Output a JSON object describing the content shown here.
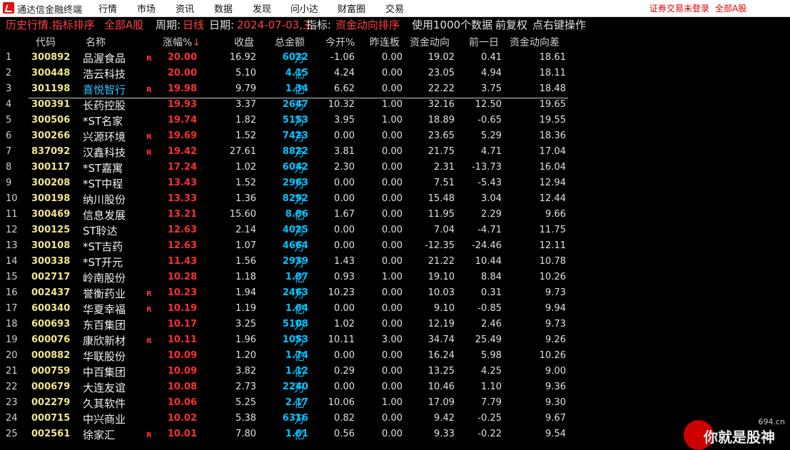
{
  "app": {
    "name": "通达信金融终端"
  },
  "menu": [
    "行情",
    "市场",
    "资讯",
    "数据",
    "发现",
    "问小达",
    "财富圈",
    "交易"
  ],
  "status": {
    "login": "证券交易未登录",
    "market": "全部A股"
  },
  "info": {
    "title": "历史行情.指标排序",
    "scope": "全部A股",
    "period_label": "周期:",
    "period": "日线",
    "date_label": "日期:",
    "date": "2024-07-03,三",
    "indicator_label": "指标:",
    "indicator": "资金动向排序",
    "data_note": "使用1000个数据",
    "adjust": "前复权",
    "hint": "点右键操作"
  },
  "columns": [
    "代码",
    "名称",
    "涨幅%",
    "收盘",
    "总金额",
    "今开%",
    "昨连板",
    "资金动向",
    "前一日",
    "资金动向差"
  ],
  "sort_arrow": "↓",
  "colors": {
    "up": "#ff3030",
    "code": "#f0e68c",
    "amount": "#00c4ff",
    "selected_name": "#2ec7ff"
  },
  "rows": [
    {
      "idx": "1",
      "code": "300892",
      "name": "品渥食品",
      "mark": "R",
      "chg": "20.00",
      "close": "16.92",
      "amt": "6022",
      "unit": "万",
      "open": "-1.06",
      "streak": "0.00",
      "flow": "19.02",
      "prev": "0.41",
      "diff": "18.61"
    },
    {
      "idx": "2",
      "code": "300448",
      "name": "浩云科技",
      "mark": "",
      "chg": "20.00",
      "close": "5.10",
      "amt": "4.15",
      "unit": "亿",
      "open": "4.24",
      "streak": "0.00",
      "flow": "23.05",
      "prev": "4.94",
      "diff": "18.11"
    },
    {
      "idx": "3",
      "code": "301198",
      "name": "喜悦智行",
      "mark": "R",
      "chg": "19.98",
      "close": "9.79",
      "amt": "1.34",
      "unit": "亿",
      "open": "6.62",
      "streak": "0.00",
      "flow": "22.22",
      "prev": "3.75",
      "diff": "18.48"
    },
    {
      "idx": "4",
      "code": "300391",
      "name": "长药控股",
      "mark": "",
      "chg": "19.93",
      "close": "3.37",
      "amt": "2647",
      "unit": "万",
      "open": "10.32",
      "streak": "1.00",
      "flow": "32.16",
      "prev": "12.50",
      "diff": "19.65"
    },
    {
      "idx": "5",
      "code": "300506",
      "name": "*ST名家",
      "mark": "",
      "chg": "19.74",
      "close": "1.82",
      "amt": "5153",
      "unit": "万",
      "open": "3.95",
      "streak": "1.00",
      "flow": "18.89",
      "prev": "-0.65",
      "diff": "19.55"
    },
    {
      "idx": "6",
      "code": "300266",
      "name": "兴源环境",
      "mark": "R",
      "chg": "19.69",
      "close": "1.52",
      "amt": "7423",
      "unit": "万",
      "open": "0.00",
      "streak": "0.00",
      "flow": "23.65",
      "prev": "5.29",
      "diff": "18.36"
    },
    {
      "idx": "7",
      "code": "837092",
      "name": "汉鑫科技",
      "mark": "R",
      "chg": "19.42",
      "close": "27.61",
      "amt": "8822",
      "unit": "万",
      "open": "3.81",
      "streak": "0.00",
      "flow": "21.75",
      "prev": "4.71",
      "diff": "17.04"
    },
    {
      "idx": "8",
      "code": "300117",
      "name": "*ST嘉寓",
      "mark": "",
      "chg": "17.24",
      "close": "1.02",
      "amt": "6042",
      "unit": "万",
      "open": "2.30",
      "streak": "0.00",
      "flow": "2.31",
      "prev": "-13.73",
      "diff": "16.04"
    },
    {
      "idx": "9",
      "code": "300208",
      "name": "*ST中程",
      "mark": "",
      "chg": "13.43",
      "close": "1.52",
      "amt": "2963",
      "unit": "万",
      "open": "0.00",
      "streak": "0.00",
      "flow": "7.51",
      "prev": "-5.43",
      "diff": "12.94"
    },
    {
      "idx": "10",
      "code": "300198",
      "name": "纳川股份",
      "mark": "",
      "chg": "13.33",
      "close": "1.36",
      "amt": "8292",
      "unit": "万",
      "open": "0.00",
      "streak": "0.00",
      "flow": "15.48",
      "prev": "3.04",
      "diff": "12.44"
    },
    {
      "idx": "11",
      "code": "300469",
      "name": "信息发展",
      "mark": "",
      "chg": "13.21",
      "close": "15.60",
      "amt": "8.86",
      "unit": "亿",
      "open": "1.67",
      "streak": "0.00",
      "flow": "11.95",
      "prev": "2.29",
      "diff": "9.66"
    },
    {
      "idx": "12",
      "code": "300125",
      "name": "ST聆达",
      "mark": "",
      "chg": "12.63",
      "close": "2.14",
      "amt": "4025",
      "unit": "万",
      "open": "0.00",
      "streak": "0.00",
      "flow": "7.04",
      "prev": "-4.71",
      "diff": "11.75"
    },
    {
      "idx": "13",
      "code": "300108",
      "name": "*ST吉药",
      "mark": "",
      "chg": "12.63",
      "close": "1.07",
      "amt": "4664",
      "unit": "万",
      "open": "0.00",
      "streak": "0.00",
      "flow": "-12.35",
      "prev": "-24.46",
      "diff": "12.11"
    },
    {
      "idx": "14",
      "code": "300338",
      "name": "*ST开元",
      "mark": "",
      "chg": "11.43",
      "close": "1.56",
      "amt": "2939",
      "unit": "万",
      "open": "1.43",
      "streak": "0.00",
      "flow": "21.22",
      "prev": "10.44",
      "diff": "10.78"
    },
    {
      "idx": "15",
      "code": "002717",
      "name": "岭南股份",
      "mark": "",
      "chg": "10.28",
      "close": "1.18",
      "amt": "1.87",
      "unit": "亿",
      "open": "0.93",
      "streak": "1.00",
      "flow": "19.10",
      "prev": "8.84",
      "diff": "10.26"
    },
    {
      "idx": "16",
      "code": "002437",
      "name": "誉衡药业",
      "mark": "R",
      "chg": "10.23",
      "close": "1.94",
      "amt": "2463",
      "unit": "万",
      "open": "10.23",
      "streak": "0.00",
      "flow": "10.03",
      "prev": "0.31",
      "diff": "9.73"
    },
    {
      "idx": "17",
      "code": "600340",
      "name": "华夏幸福",
      "mark": "R",
      "chg": "10.19",
      "close": "1.19",
      "amt": "1.64",
      "unit": "亿",
      "open": "0.00",
      "streak": "0.00",
      "flow": "9.10",
      "prev": "-0.85",
      "diff": "9.94"
    },
    {
      "idx": "18",
      "code": "600693",
      "name": "东百集团",
      "mark": "",
      "chg": "10.17",
      "close": "3.25",
      "amt": "5108",
      "unit": "万",
      "open": "1.02",
      "streak": "0.00",
      "flow": "12.19",
      "prev": "2.46",
      "diff": "9.73"
    },
    {
      "idx": "19",
      "code": "600076",
      "name": "康欣新材",
      "mark": "R",
      "chg": "10.11",
      "close": "1.96",
      "amt": "1053",
      "unit": "万",
      "open": "10.11",
      "streak": "3.00",
      "flow": "34.74",
      "prev": "25.49",
      "diff": "9.26"
    },
    {
      "idx": "20",
      "code": "000882",
      "name": "华联股份",
      "mark": "",
      "chg": "10.09",
      "close": "1.20",
      "amt": "1.74",
      "unit": "亿",
      "open": "0.00",
      "streak": "0.00",
      "flow": "16.24",
      "prev": "5.98",
      "diff": "10.26"
    },
    {
      "idx": "21",
      "code": "000759",
      "name": "中百集团",
      "mark": "",
      "chg": "10.09",
      "close": "3.82",
      "amt": "1.12",
      "unit": "亿",
      "open": "0.29",
      "streak": "0.00",
      "flow": "13.25",
      "prev": "4.25",
      "diff": "9.00"
    },
    {
      "idx": "22",
      "code": "000679",
      "name": "大连友谊",
      "mark": "",
      "chg": "10.08",
      "close": "2.73",
      "amt": "2240",
      "unit": "万",
      "open": "0.00",
      "streak": "0.00",
      "flow": "10.46",
      "prev": "1.10",
      "diff": "9.36"
    },
    {
      "idx": "23",
      "code": "002279",
      "name": "久其软件",
      "mark": "",
      "chg": "10.06",
      "close": "5.25",
      "amt": "2.17",
      "unit": "亿",
      "open": "10.06",
      "streak": "1.00",
      "flow": "17.09",
      "prev": "7.79",
      "diff": "9.30"
    },
    {
      "idx": "24",
      "code": "000715",
      "name": "中兴商业",
      "mark": "",
      "chg": "10.02",
      "close": "5.38",
      "amt": "6316",
      "unit": "万",
      "open": "0.82",
      "streak": "0.00",
      "flow": "9.42",
      "prev": "-0.25",
      "diff": "9.67"
    },
    {
      "idx": "25",
      "code": "002561",
      "name": "徐家汇",
      "mark": "R",
      "chg": "10.01",
      "close": "7.80",
      "amt": "1.61",
      "unit": "亿",
      "open": "0.56",
      "streak": "0.00",
      "flow": "9.33",
      "prev": "-0.22",
      "diff": "9.54"
    }
  ],
  "watermark": {
    "site": "694.cn",
    "text": "你就是股神"
  }
}
